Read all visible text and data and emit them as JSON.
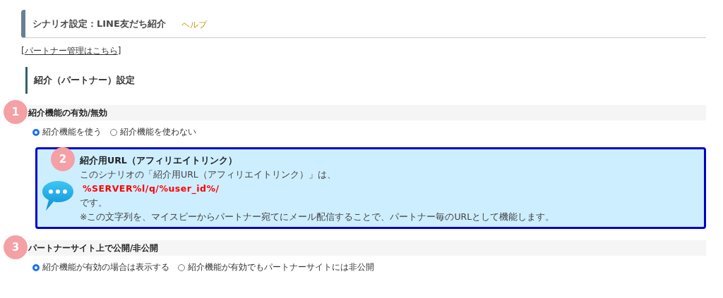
{
  "header": {
    "title": "シナリオ設定：LINE友だち紹介",
    "help_link": "ヘルプ"
  },
  "partner_link": {
    "open": "[",
    "label": "パートナー管理はこちら",
    "close": "]"
  },
  "subheading": "紹介（パートナー）設定",
  "blocks": [
    {
      "kind": "radio_group",
      "badge": "1",
      "title": "紹介機能の有効/無効",
      "options": [
        {
          "label": "紹介機能を使う",
          "selected": true
        },
        {
          "label": "紹介機能を使わない",
          "selected": false
        }
      ]
    },
    {
      "kind": "info_box",
      "badge": "2",
      "title": "紹介用URL（アフィリエイトリンク）",
      "lines": [
        {
          "kind": "text",
          "text": "このシナリオの「紹介用URL（アフィリエイトリンク）」は、"
        },
        {
          "kind": "code",
          "text": "%SERVER%l/q/%user_id%/"
        },
        {
          "kind": "text",
          "text": "です。"
        },
        {
          "kind": "text",
          "text": "※この文字列を、マイスピーからパートナー宛てにメール配信することで、パートナー毎のURLとして機能します。"
        }
      ]
    },
    {
      "kind": "radio_group",
      "badge": "3",
      "title": "パートナーサイト上で公開/非公開",
      "options": [
        {
          "label": "紹介機能が有効の場合は表示する",
          "selected": true
        },
        {
          "label": "紹介機能が有効でもパートナーサイトには非公開",
          "selected": false
        }
      ]
    }
  ]
}
